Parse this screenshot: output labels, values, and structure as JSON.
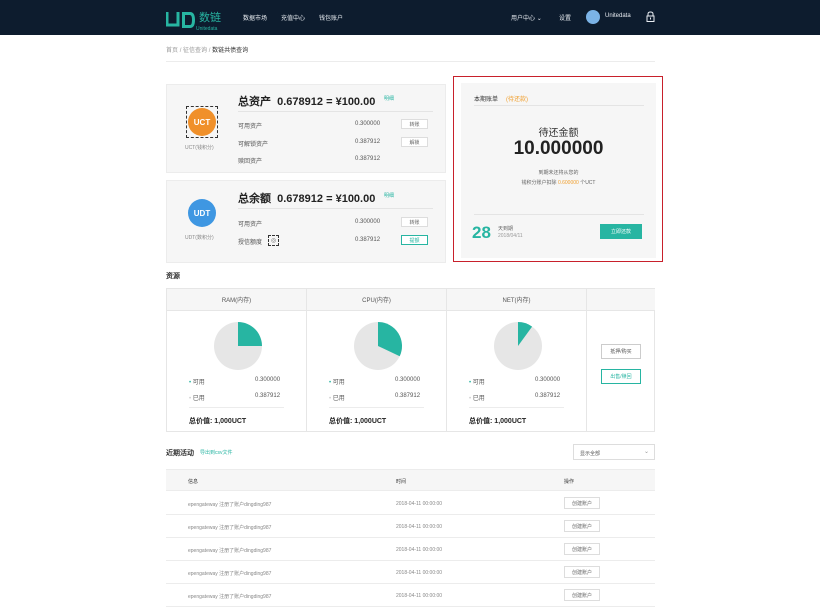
{
  "header": {
    "logo_cn": "数链",
    "logo_en": "Unitedata",
    "nav": [
      "数据市场",
      "充值中心",
      "钱包账户"
    ],
    "user_center": "用户中心",
    "settings": "设置",
    "username": "Unitedata"
  },
  "breadcrumb": [
    "首页",
    "征信查询",
    "数链共债查询"
  ],
  "uct": {
    "total_label": "总资产",
    "total_amount": "0.678912",
    "eq": "=",
    "cny": "¥100.00",
    "detail": "明细",
    "coin": "UCT",
    "coin_label": "UCT(钱积分)",
    "rows": [
      {
        "label": "可用资产",
        "value": "0.300000",
        "btn": "转账"
      },
      {
        "label": "可解锁资产",
        "value": "0.387912",
        "btn": "解锁"
      },
      {
        "label": "赎回资产",
        "value": "0.387912",
        "btn": ""
      }
    ]
  },
  "udt": {
    "total_label": "总余额",
    "total_amount": "0.678912",
    "eq": "=",
    "cny": "¥100.00",
    "detail": "明细",
    "coin": "UDT",
    "coin_label": "UDT(数积分)",
    "rows": [
      {
        "label": "可用资产",
        "value": "0.300000",
        "btn": "转账"
      },
      {
        "label": "授信额度",
        "value": "0.387912",
        "btn": "提额"
      }
    ]
  },
  "bill": {
    "title": "本期账单",
    "status": "(待还款)",
    "due_label": "待还金额",
    "due_amount": "10.000000",
    "note1": "到期未还将从您的",
    "note2_pre": "钱积分账户扣除",
    "note2_amount": "0.600000",
    "note2_post": "个UCT",
    "days": "28",
    "days_label": "天到期",
    "date": "2018/04/11",
    "repay_btn": "立即还款"
  },
  "resources": {
    "title": "资源",
    "cols": [
      {
        "name": "RAM(内存)",
        "available_label": "可用",
        "available": "0.300000",
        "used_label": "已用",
        "used": "0.387912",
        "total_label": "总价值:",
        "total": "1,000UCT",
        "fraction": 0.25
      },
      {
        "name": "CPU(内存)",
        "available_label": "可用",
        "available": "0.300000",
        "used_label": "已用",
        "used": "0.387912",
        "total_label": "总价值:",
        "total": "1,000UCT",
        "fraction": 0.32
      },
      {
        "name": "NET(内存)",
        "available_label": "可用",
        "available": "0.300000",
        "used_label": "已用",
        "used": "0.387912",
        "total_label": "总价值:",
        "total": "1,000UCT",
        "fraction": 0.1
      }
    ],
    "btn_buy": "抵押/购买",
    "btn_sell": "出售/赎回",
    "accent": "#27b5a2"
  },
  "activity": {
    "title": "近期活动",
    "export": "导出到csv文件",
    "select": "显示全部",
    "headers": [
      "信息",
      "时间",
      "操作"
    ],
    "rows": [
      {
        "info": "epengateway 注册了账户dingding987",
        "time": "2018-04-11 00:00:00",
        "action": "创建账户"
      },
      {
        "info": "epengateway 注册了账户dingding987",
        "time": "2018-04-11 00:00:00",
        "action": "创建账户"
      },
      {
        "info": "epengateway 注册了账户dingding987",
        "time": "2018-04-11 00:00:00",
        "action": "创建账户"
      },
      {
        "info": "epengateway 注册了账户dingding987",
        "time": "2018-04-11 00:00:00",
        "action": "创建账户"
      },
      {
        "info": "epengateway 注册了账户dingding987",
        "time": "2018-04-11 00:00:00",
        "action": "创建账户"
      }
    ]
  }
}
